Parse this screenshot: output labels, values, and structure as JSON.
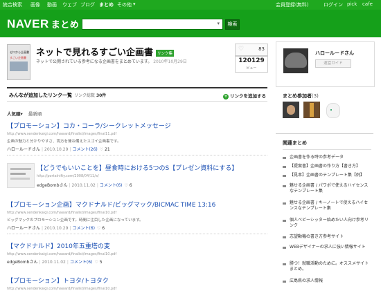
{
  "topbar": {
    "left": [
      "統合検索",
      "画像",
      "動画",
      "ウェブ",
      "ブログ",
      "まとめ",
      "その他"
    ],
    "right": [
      "会員登録(無料)",
      "ログイン",
      "pick",
      "cafe"
    ]
  },
  "header": {
    "logo": "NAVER",
    "logo_sub": "まとめ",
    "search_placeholder": "",
    "search_button": "検索"
  },
  "article": {
    "title": "ネットで見れるすごい企画書",
    "badge": "リンク集",
    "description": "ネットで公開されている参考になる企画書をまとめています。",
    "date": "2010年10月29日",
    "thumb_title": "ゼロから企画書",
    "thumb_sub": "すごい企画書",
    "favorites": "83",
    "views": "120129",
    "views_label": "ビュー"
  },
  "list_header": {
    "title": "みんなが追加したリンク一覧",
    "count_label": "リンク総数",
    "count": "30件",
    "add_link": "リンクを追加する"
  },
  "sort": {
    "popular": "人気順",
    "latest": "最新順"
  },
  "items": [
    {
      "title": "【プロモーション】コカ・コーラ/シークレットメッセージ",
      "url": "http://www.sendenkaigi.com/haward/finalist/images/final11.pdf",
      "desc": "企画の魅力と分かりやすさ、両方を兼ね備えたスゴイ企画書です。",
      "user": "ハロールードさん",
      "date": "2010.10.29",
      "comments": "コメント(26)",
      "hearts": "21"
    },
    {
      "title": "【どうでもいいことを】昼食時における5つのS【プレゼン資料にする】",
      "url": "http://portalnifty.com/2008/04/11/a/",
      "desc": "",
      "user": "edgeBombさん",
      "date": "2010.11.02",
      "comments": "コメント(6)",
      "hearts": "6"
    },
    {
      "title": "【プロモーション企画】マクドナルド/ビッグマック/BICMAC TIME 13:16",
      "url": "http://www.sendenkaigi.com/haward/finalist/images/final10.pdf",
      "desc": "ビッグマックのプロモーション企画です。時間に注目した企画になっています。",
      "user": "ハロールードさん",
      "date": "2010.10.29",
      "comments": "コメント(6)",
      "hearts": "6"
    },
    {
      "title": "【マクドナルド】2010年五重塔の変",
      "url": "http://www.sendenkaigi.com/haward/finalist/images/final10.pdf",
      "desc": "",
      "user": "edgeBombさん",
      "date": "2010.11.02",
      "comments": "コメント(6)",
      "hearts": "5"
    },
    {
      "title": "【プロモーション】トヨタ/トヨタク",
      "url": "http://www.sendenkaigi.com/haward/finalist/images/final10.pdf",
      "desc": "",
      "user": "",
      "date": "",
      "comments": "",
      "hearts": ""
    }
  ],
  "sidebar": {
    "profile_name": "ハロールードさん",
    "profile_button": "運営ガイド",
    "participants_title": "まとめ参加者",
    "participants_count": "(3)",
    "related_title": "関連まとめ",
    "related": [
      "企画書を作る時の参考データ",
      "【提案書】企画書の作り方【書き方】",
      "【見本】企画書のテンプレート集【例】",
      "魅せる企画書 / パワポで使えるハイセンスなテンプレート集",
      "魅せる企画書 / キーノートで使えるハイセンスなテンプレート集",
      "個人ベビーシッター始めたい人向け参考リンク",
      "志望動機の書き方参考サイト",
      "WEBデザイナーの求人に強い情報サイト",
      "勝つ！就職活動のために。オススメサイトまとめ。",
      "広島県の求人情報"
    ]
  }
}
